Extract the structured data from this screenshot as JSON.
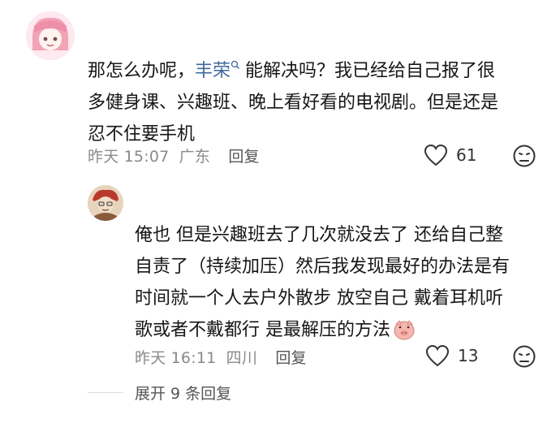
{
  "comment1": {
    "text_before_mention": "那怎么办呢，",
    "mention": "丰荣",
    "text_after_mention": "能解决吗？我已经给自己报了很",
    "line2": "多健身课、兴趣班、晚上看好看的电视剧。但是还是",
    "line3": "忍不住要手机",
    "time": "昨天 15:07",
    "location": "广东",
    "reply_label": "回复",
    "likes": "61"
  },
  "comment2": {
    "line1": "俺也 但是兴趣班去了几次就没去了 还给自己整",
    "line2": "自责了（持续加压）然后我发现最好的办法是有",
    "line3": "时间就一个人去户外散步 放空自己 戴着耳机听",
    "line4": "歌或者不戴都行 是最解压的方法",
    "time": "昨天 16:11",
    "location": "四川",
    "reply_label": "回复",
    "likes": "13"
  },
  "expand_replies_label": "展开 9 条回复",
  "colors": {
    "mention": "#3f6a9b",
    "meta": "#8a8a8a",
    "accent_avatar1": "#f3a3b8"
  }
}
